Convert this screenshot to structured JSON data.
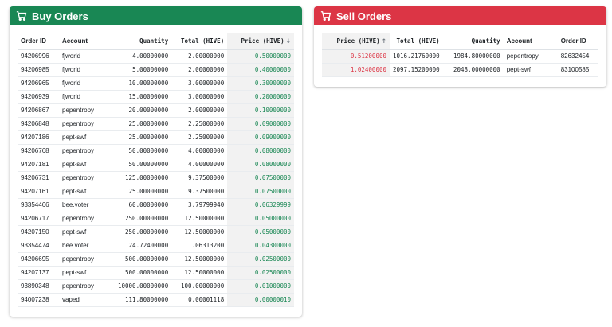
{
  "buy": {
    "title": "Buy Orders",
    "headers": {
      "order_id": "Order ID",
      "account": "Account",
      "quantity": "Quantity",
      "total": "Total (HIVE)",
      "price": "Price (HIVE)",
      "sort_arrow": "↓"
    },
    "rows": [
      {
        "id": "94206996",
        "account": "fjworld",
        "quantity": "4.00000000",
        "total": "2.00000000",
        "price": "0.50000000"
      },
      {
        "id": "94206985",
        "account": "fjworld",
        "quantity": "5.00000000",
        "total": "2.00000000",
        "price": "0.40000000"
      },
      {
        "id": "94206965",
        "account": "fjworld",
        "quantity": "10.00000000",
        "total": "3.00000000",
        "price": "0.30000000"
      },
      {
        "id": "94206939",
        "account": "fjworld",
        "quantity": "15.00000000",
        "total": "3.00000000",
        "price": "0.20000000"
      },
      {
        "id": "94206867",
        "account": "pepentropy",
        "quantity": "20.00000000",
        "total": "2.00000000",
        "price": "0.10000000"
      },
      {
        "id": "94206848",
        "account": "pepentropy",
        "quantity": "25.00000000",
        "total": "2.25000000",
        "price": "0.09000000"
      },
      {
        "id": "94207186",
        "account": "pept-swf",
        "quantity": "25.00000000",
        "total": "2.25000000",
        "price": "0.09000000"
      },
      {
        "id": "94206768",
        "account": "pepentropy",
        "quantity": "50.00000000",
        "total": "4.00000000",
        "price": "0.08000000"
      },
      {
        "id": "94207181",
        "account": "pept-swf",
        "quantity": "50.00000000",
        "total": "4.00000000",
        "price": "0.08000000"
      },
      {
        "id": "94206731",
        "account": "pepentropy",
        "quantity": "125.00000000",
        "total": "9.37500000",
        "price": "0.07500000"
      },
      {
        "id": "94207161",
        "account": "pept-swf",
        "quantity": "125.00000000",
        "total": "9.37500000",
        "price": "0.07500000"
      },
      {
        "id": "93354466",
        "account": "bee.voter",
        "quantity": "60.00000000",
        "total": "3.79799940",
        "price": "0.06329999"
      },
      {
        "id": "94206717",
        "account": "pepentropy",
        "quantity": "250.00000000",
        "total": "12.50000000",
        "price": "0.05000000"
      },
      {
        "id": "94207150",
        "account": "pept-swf",
        "quantity": "250.00000000",
        "total": "12.50000000",
        "price": "0.05000000"
      },
      {
        "id": "93354474",
        "account": "bee.voter",
        "quantity": "24.72400000",
        "total": "1.06313200",
        "price": "0.04300000"
      },
      {
        "id": "94206695",
        "account": "pepentropy",
        "quantity": "500.00000000",
        "total": "12.50000000",
        "price": "0.02500000"
      },
      {
        "id": "94207137",
        "account": "pept-swf",
        "quantity": "500.00000000",
        "total": "12.50000000",
        "price": "0.02500000"
      },
      {
        "id": "93890348",
        "account": "pepentropy",
        "quantity": "10000.00000000",
        "total": "100.00000000",
        "price": "0.01000000"
      },
      {
        "id": "94007238",
        "account": "vaped",
        "quantity": "111.80000000",
        "total": "0.00001118",
        "price": "0.00000010"
      }
    ]
  },
  "sell": {
    "title": "Sell Orders",
    "headers": {
      "price": "Price (HIVE)",
      "sort_arrow": "↑",
      "total": "Total (HIVE)",
      "quantity": "Quantity",
      "account": "Account",
      "order_id": "Order ID"
    },
    "rows": [
      {
        "price": "0.51200000",
        "total": "1016.21760000",
        "quantity": "1984.80000000",
        "account": "pepentropy",
        "id": "82632454"
      },
      {
        "price": "1.02400000",
        "total": "2097.15200000",
        "quantity": "2048.00000000",
        "account": "pept-swf",
        "id": "83100585"
      }
    ]
  },
  "colors": {
    "buy_header": "#198754",
    "sell_header": "#dc3545",
    "buy_price": "#198754",
    "sell_price": "#dc3545"
  },
  "icons": {
    "header_icon": "cart-icon"
  }
}
